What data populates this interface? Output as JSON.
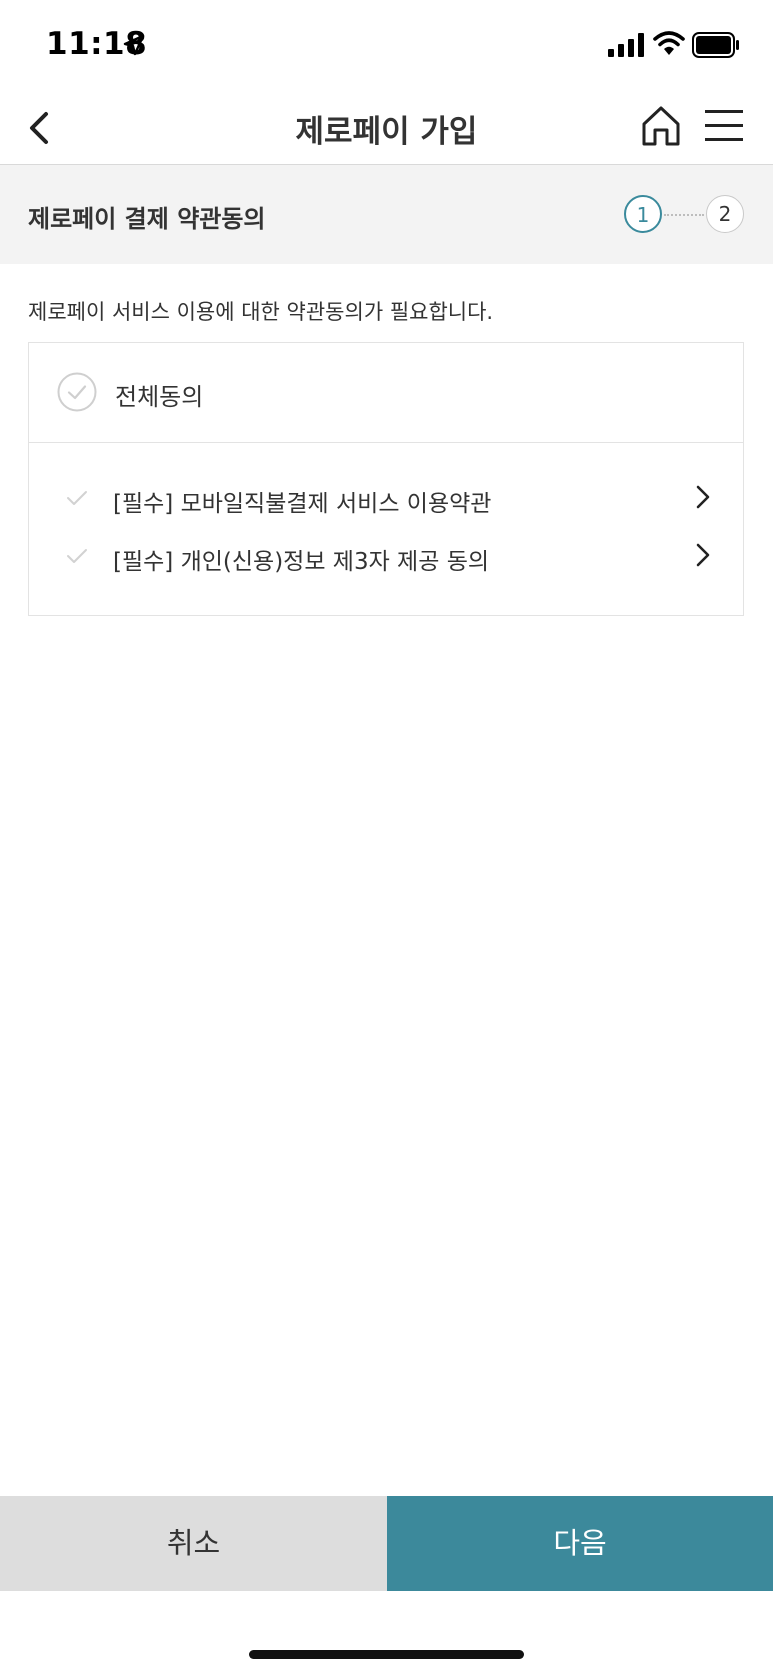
{
  "status_bar": {
    "time": "11:18"
  },
  "header": {
    "title": "제로페이 가입"
  },
  "step": {
    "title": "제로페이 결제 약관동의",
    "steps": [
      "1",
      "2"
    ],
    "current": 1,
    "accent_color": "#3a8a9c"
  },
  "intro_text": "제로페이 서비스 이용에 대한 약관동의가 필요합니다.",
  "terms": {
    "agree_all_label": "전체동의",
    "items": [
      {
        "label": "[필수] 모바일직불결제 서비스 이용약관"
      },
      {
        "label": "[필수] 개인(신용)정보 제3자 제공 동의"
      }
    ]
  },
  "buttons": {
    "cancel": "취소",
    "next": "다음",
    "next_color": "#3c899b"
  }
}
